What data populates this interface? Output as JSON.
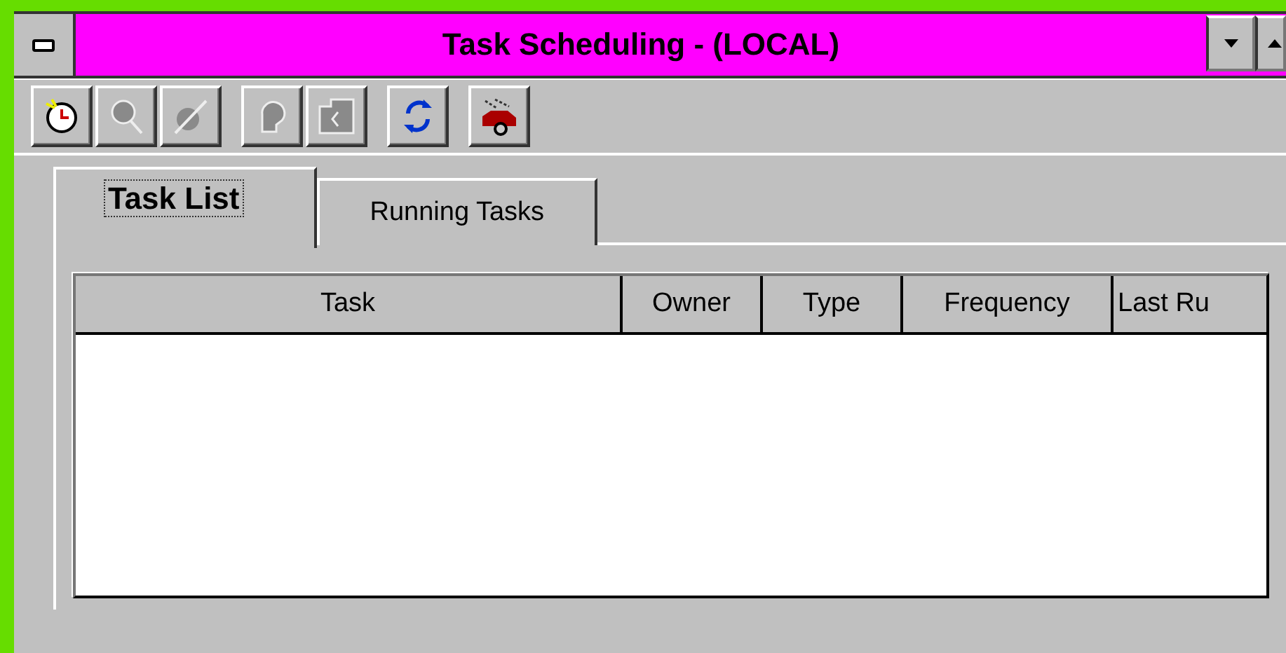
{
  "window": {
    "title": "Task Scheduling - (LOCAL)"
  },
  "toolbar": [
    [
      {
        "kind": "clock",
        "disabled": false
      },
      {
        "kind": "magnifier",
        "disabled": true
      },
      {
        "kind": "pin",
        "disabled": true
      }
    ],
    [
      {
        "kind": "head",
        "disabled": true
      },
      {
        "kind": "page",
        "disabled": true
      }
    ],
    [
      {
        "kind": "refresh",
        "disabled": false
      }
    ],
    [
      {
        "kind": "car",
        "disabled": false
      }
    ]
  ],
  "tabs": [
    {
      "label": "Task List",
      "selected": true
    },
    {
      "label": "Running Tasks",
      "selected": false
    }
  ],
  "table": {
    "columns": [
      "Task",
      "Owner",
      "Type",
      "Frequency",
      "Last Ru"
    ]
  }
}
